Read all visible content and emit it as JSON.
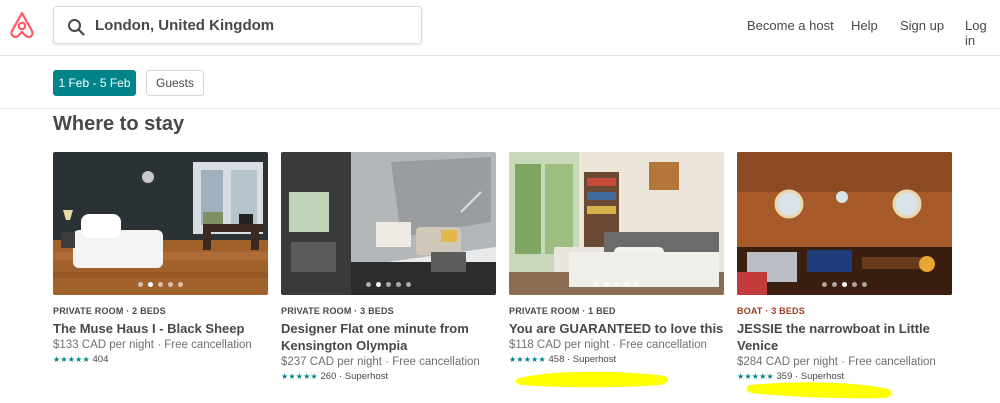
{
  "header": {
    "logo": "airbnb-logo",
    "search_value": "London, United Kingdom",
    "search_icon": "magnifier-icon",
    "nav": {
      "become_host": "Become a host",
      "help": "Help",
      "sign_up": "Sign up",
      "log_in": "Log in"
    }
  },
  "filters": {
    "dates": "1 Feb - 5 Feb",
    "guests": "Guests"
  },
  "section": {
    "title": "Where to stay"
  },
  "listings": [
    {
      "kind": "PRIVATE ROOM · 2 BEDS",
      "title": "The Muse Haus I - Black Sheep",
      "price": "$133 CAD per night · Free cancellation",
      "stars": "★★★★★",
      "rating": "404",
      "photo_dots": 5,
      "active_dot": 1
    },
    {
      "kind": "PRIVATE ROOM · 3 BEDS",
      "title": "Designer Flat one minute from Kensington Olympia",
      "price": "$237 CAD per night · Free cancellation",
      "stars": "★★★★★",
      "rating": "260 · Superhost",
      "photo_dots": 5,
      "active_dot": 1
    },
    {
      "kind": "PRIVATE ROOM · 1 BED",
      "title": "You are GUARANTEED to love this",
      "price": "$118 CAD per night · Free cancellation",
      "stars": "★★★★★",
      "rating": "458 · Superhost",
      "photo_dots": 5,
      "active_dot": 1
    },
    {
      "kind": "BOAT · 3 BEDS",
      "title": "JESSIE the narrowboat in Little Venice",
      "price": "$284 CAD per night · Free cancellation",
      "stars": "★★★★★",
      "rating": "359 · Superhost",
      "photo_dots": 5,
      "active_dot": 2
    }
  ],
  "colors": {
    "brand": "#ff5a5f",
    "accent_teal": "#008489",
    "boat_kind": "#9a3e1f",
    "highlighter": "#ffff00"
  }
}
